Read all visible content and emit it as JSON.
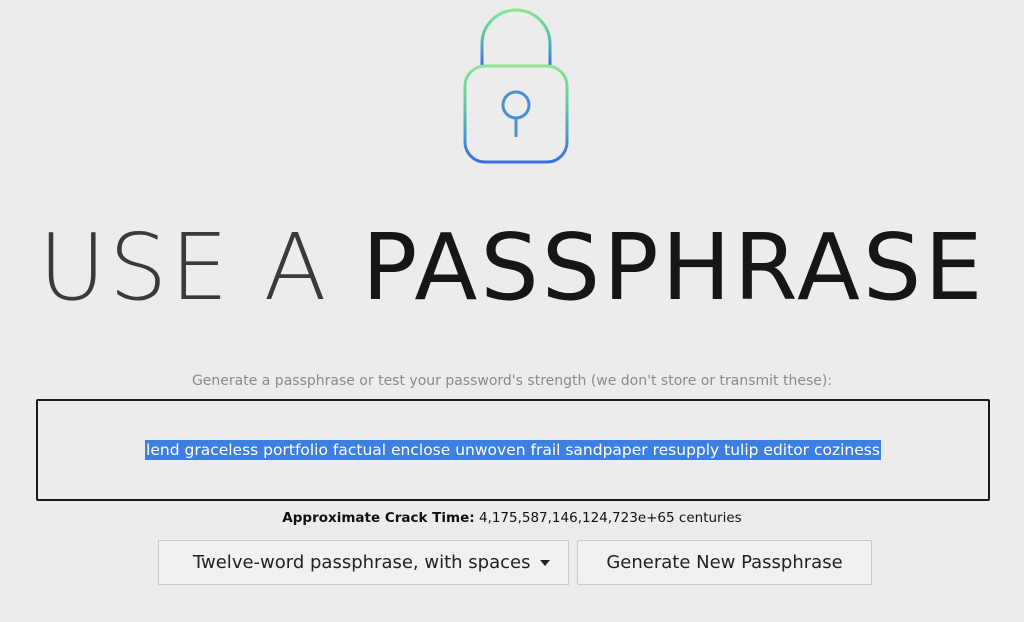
{
  "header": {
    "icon": "lock-icon",
    "title_light": "USE A",
    "title_bold": "PASSPHRASE"
  },
  "instruction": "Generate a passphrase or test your password's strength (we don't store or transmit these):",
  "passphrase": {
    "value": "lend graceless portfolio factual enclose unwoven frail sandpaper resupply tulip editor coziness",
    "selection_color": "#3d7fe0"
  },
  "crack_time": {
    "label": "Approximate Crack Time:",
    "value": "4,175,587,146,124,723e+65 centuries"
  },
  "controls": {
    "format_select": {
      "selected": "Twelve-word passphrase, with spaces",
      "icon": "caret-down-icon"
    },
    "generate_button": "Generate New Passphrase"
  },
  "colors": {
    "background": "#ececec",
    "lock_gradient_top": "#7fe08a",
    "lock_gradient_bottom": "#3a6fe6"
  }
}
